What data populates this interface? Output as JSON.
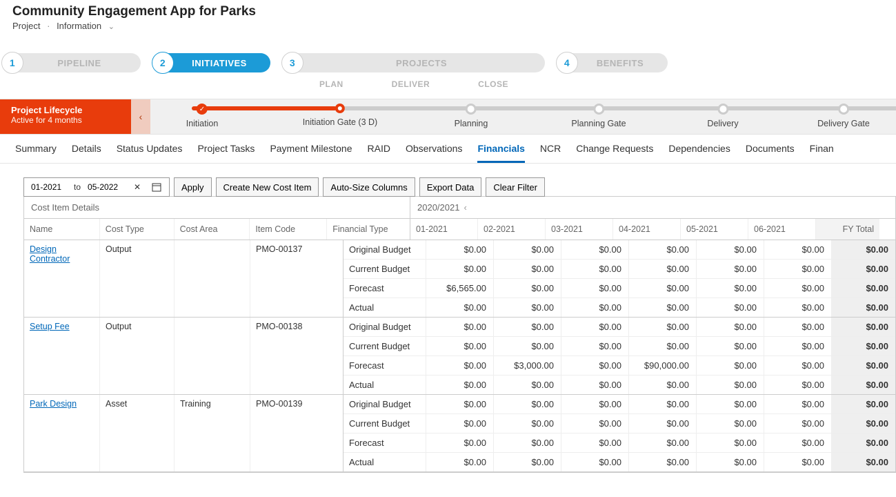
{
  "header": {
    "title": "Community Engagement App for Parks",
    "breadcrumb": [
      "Project",
      "Information"
    ]
  },
  "stages": [
    {
      "num": "1",
      "label": "PIPELINE",
      "active": false,
      "width": "w1"
    },
    {
      "num": "2",
      "label": "INITIATIVES",
      "active": true,
      "width": "w2"
    },
    {
      "num": "3",
      "label": "PROJECTS",
      "active": false,
      "width": "w3"
    },
    {
      "num": "4",
      "label": "BENEFITS",
      "active": false,
      "width": "w4"
    }
  ],
  "subphases": [
    "PLAN",
    "DELIVER",
    "CLOSE"
  ],
  "lifecycle": {
    "title": "Project Lifecycle",
    "subtitle": "Active for 4 months",
    "nodes": [
      {
        "label": "Initiation",
        "state": "done",
        "pos": 75
      },
      {
        "label": "Initiation Gate  (3 D)",
        "state": "current",
        "pos": 275
      },
      {
        "label": "Planning",
        "state": "future",
        "pos": 465
      },
      {
        "label": "Planning Gate",
        "state": "future",
        "pos": 650
      },
      {
        "label": "Delivery",
        "state": "future",
        "pos": 830
      },
      {
        "label": "Delivery Gate",
        "state": "future",
        "pos": 1005
      }
    ]
  },
  "tabs": [
    "Summary",
    "Details",
    "Status Updates",
    "Project Tasks",
    "Payment Milestone",
    "RAID",
    "Observations",
    "Financials",
    "NCR",
    "Change Requests",
    "Dependencies",
    "Documents",
    "Finan"
  ],
  "activeTab": "Financials",
  "toolbar": {
    "from": "01-2021",
    "to_label": "to",
    "to": "05-2022",
    "apply": "Apply",
    "create": "Create New Cost Item",
    "autosize": "Auto-Size Columns",
    "export": "Export Data",
    "clear": "Clear Filter"
  },
  "gridTop": {
    "left": "Cost Item Details",
    "right": "2020/2021"
  },
  "columns": {
    "left": [
      "Name",
      "Cost Type",
      "Cost Area",
      "Item Code",
      "Financial Type"
    ],
    "months": [
      "01-2021",
      "02-2021",
      "03-2021",
      "04-2021",
      "05-2021",
      "06-2021"
    ],
    "total": "FY Total"
  },
  "finTypes": [
    "Original Budget",
    "Current Budget",
    "Forecast",
    "Actual"
  ],
  "rows": [
    {
      "name": "Design Contractor",
      "costType": "Output",
      "costArea": "",
      "itemCode": "PMO-00137",
      "values": {
        "Original Budget": [
          "$0.00",
          "$0.00",
          "$0.00",
          "$0.00",
          "$0.00",
          "$0.00",
          "$0.00"
        ],
        "Current Budget": [
          "$0.00",
          "$0.00",
          "$0.00",
          "$0.00",
          "$0.00",
          "$0.00",
          "$0.00"
        ],
        "Forecast": [
          "$6,565.00",
          "$0.00",
          "$0.00",
          "$0.00",
          "$0.00",
          "$0.00",
          "$0.00"
        ],
        "Actual": [
          "$0.00",
          "$0.00",
          "$0.00",
          "$0.00",
          "$0.00",
          "$0.00",
          "$0.00"
        ]
      }
    },
    {
      "name": "Setup Fee",
      "costType": "Output",
      "costArea": "",
      "itemCode": "PMO-00138",
      "values": {
        "Original Budget": [
          "$0.00",
          "$0.00",
          "$0.00",
          "$0.00",
          "$0.00",
          "$0.00",
          "$0.00"
        ],
        "Current Budget": [
          "$0.00",
          "$0.00",
          "$0.00",
          "$0.00",
          "$0.00",
          "$0.00",
          "$0.00"
        ],
        "Forecast": [
          "$0.00",
          "$3,000.00",
          "$0.00",
          "$90,000.00",
          "$0.00",
          "$0.00",
          "$0.00"
        ],
        "Actual": [
          "$0.00",
          "$0.00",
          "$0.00",
          "$0.00",
          "$0.00",
          "$0.00",
          "$0.00"
        ]
      }
    },
    {
      "name": "Park Design",
      "costType": "Asset",
      "costArea": "Training",
      "itemCode": "PMO-00139",
      "values": {
        "Original Budget": [
          "$0.00",
          "$0.00",
          "$0.00",
          "$0.00",
          "$0.00",
          "$0.00",
          "$0.00"
        ],
        "Current Budget": [
          "$0.00",
          "$0.00",
          "$0.00",
          "$0.00",
          "$0.00",
          "$0.00",
          "$0.00"
        ],
        "Forecast": [
          "$0.00",
          "$0.00",
          "$0.00",
          "$0.00",
          "$0.00",
          "$0.00",
          "$0.00"
        ],
        "Actual": [
          "$0.00",
          "$0.00",
          "$0.00",
          "$0.00",
          "$0.00",
          "$0.00",
          "$0.00"
        ]
      }
    }
  ]
}
